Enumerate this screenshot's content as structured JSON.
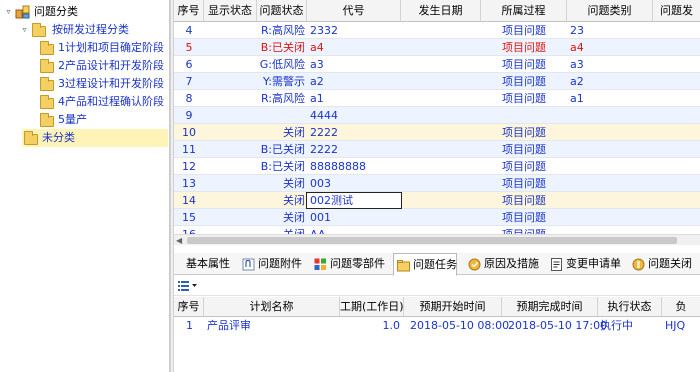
{
  "tree": {
    "root": "问题分类",
    "group": "按研发过程分类",
    "stages": [
      "1计划和项目确定阶段",
      "2产品设计和开发阶段",
      "3过程设计和开发阶段",
      "4产品和过程确认阶段",
      "5量产"
    ],
    "uncategorized": "未分类"
  },
  "table": {
    "headers": [
      "序号",
      "显示状态",
      "问题状态",
      "代号",
      "发生日期",
      "所属过程",
      "问题类别",
      "问题发"
    ],
    "rows": [
      {
        "no": "4",
        "display": "",
        "status": "R:高风险",
        "code": "2332",
        "date": "",
        "process": "项目问题",
        "category": "23",
        "color": "blue"
      },
      {
        "no": "5",
        "display": "",
        "status": "B:已关闭",
        "code": "a4",
        "date": "",
        "process": "项目问题",
        "category": "a4",
        "color": "red"
      },
      {
        "no": "6",
        "display": "",
        "status": "G:低风险",
        "code": "a3",
        "date": "",
        "process": "项目问题",
        "category": "a3",
        "color": "blue"
      },
      {
        "no": "7",
        "display": "",
        "status": "Y:需警示",
        "code": "a2",
        "date": "",
        "process": "项目问题",
        "category": "a2",
        "color": "blue"
      },
      {
        "no": "8",
        "display": "",
        "status": "R:高风险",
        "code": "a1",
        "date": "",
        "process": "项目问题",
        "category": "a1",
        "color": "blue"
      },
      {
        "no": "9",
        "display": "",
        "status": "",
        "code": "4444",
        "date": "",
        "process": "",
        "category": "",
        "color": "blue"
      },
      {
        "no": "10",
        "display": "",
        "status": "关闭",
        "code": "2222",
        "date": "",
        "process": "项目问题",
        "category": "",
        "color": "blue"
      },
      {
        "no": "11",
        "display": "",
        "status": "B:已关闭",
        "code": "2222",
        "date": "",
        "process": "项目问题",
        "category": "",
        "color": "blue"
      },
      {
        "no": "12",
        "display": "",
        "status": "B:已关闭",
        "code": "88888888",
        "date": "",
        "process": "项目问题",
        "category": "",
        "color": "blue"
      },
      {
        "no": "13",
        "display": "",
        "status": "关闭",
        "code": "003",
        "date": "",
        "process": "项目问题",
        "category": "",
        "color": "blue"
      },
      {
        "no": "14",
        "display": "",
        "status": "关闭",
        "code": "002测试",
        "date": "",
        "process": "项目问题",
        "category": "",
        "color": "blue"
      },
      {
        "no": "15",
        "display": "",
        "status": "关闭",
        "code": "001",
        "date": "",
        "process": "项目问题",
        "category": "",
        "color": "blue"
      },
      {
        "no": "16",
        "display": "",
        "status": "关闭",
        "code": "AA",
        "date": "",
        "process": "项目问题",
        "category": "",
        "color": "blue"
      }
    ]
  },
  "tabs": [
    {
      "label": "基本属性",
      "icon": "none"
    },
    {
      "label": "问题附件",
      "icon": "paperclip-icon"
    },
    {
      "label": "问题零部件",
      "icon": "parts-icon"
    },
    {
      "label": "问题任务",
      "icon": "task-folder-icon"
    },
    {
      "label": "原因及措施",
      "icon": "cause-icon"
    },
    {
      "label": "变更申请单",
      "icon": "change-doc-icon"
    },
    {
      "label": "问题关闭",
      "icon": "close-issue-icon"
    }
  ],
  "active_tab": "问题任务",
  "tasks": {
    "headers": [
      "序号",
      "计划名称",
      "工期(工作日)",
      "预期开始时间",
      "预期完成时间",
      "执行状态",
      "负"
    ],
    "rows": [
      {
        "no": "1",
        "name": "产品评审",
        "duration": "1.0",
        "start": "2018-05-10 08:00",
        "end": "2018-05-10 17:00",
        "state": "执行中",
        "owner": "HJQ"
      }
    ]
  },
  "colors": {
    "link": "#1a33cc",
    "closed": "#e01010",
    "selection": "#fff3b8",
    "alt_row": "#eef4ff"
  }
}
